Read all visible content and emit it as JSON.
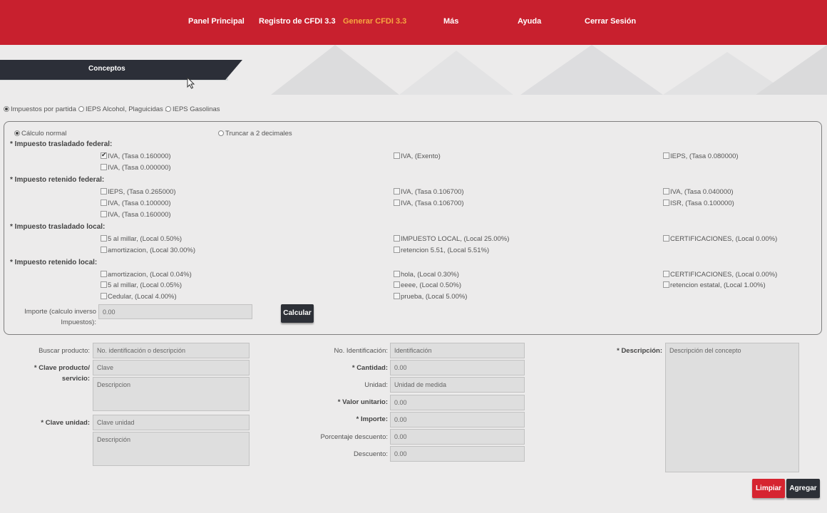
{
  "nav": {
    "items": [
      "Panel Principal",
      "Registro de CFDI 3.3",
      "Generar CFDI 3.3",
      "Más",
      "Ayuda",
      "Cerrar Sesión"
    ],
    "active_index": 2,
    "colors": {
      "bar": "#c8202e",
      "active": "#f6a640"
    }
  },
  "section": {
    "title": "Conceptos"
  },
  "tax_mode": {
    "options": [
      "Impuestos por partida",
      "IEPS Alcohol, Plaguicidas ...",
      "IEPS Gasolinas"
    ],
    "selected": 0
  },
  "calc": {
    "options": [
      "Cálculo normal",
      "Truncar a 2 decimales"
    ],
    "selected": 0
  },
  "groups": {
    "trasladado_federal": {
      "title": "* Impuesto trasladado federal:",
      "items": [
        "IVA, (Tasa 0.160000)",
        "IVA, (Exento)",
        "IEPS, (Tasa 0.080000)",
        "IVA, (Tasa 0.000000)"
      ],
      "checked": [
        true,
        false,
        false,
        false
      ]
    },
    "retenido_federal": {
      "title": "* Impuesto retenido federal:",
      "items": [
        "IEPS, (Tasa 0.265000)",
        "IVA, (Tasa 0.106700)",
        "IVA, (Tasa 0.040000)",
        "IVA, (Tasa 0.100000)",
        "IVA, (Tasa 0.106700)",
        "ISR, (Tasa 0.100000)",
        "IVA, (Tasa 0.160000)"
      ]
    },
    "trasladado_local": {
      "title": "* Impuesto trasladado local:",
      "items": [
        "5 al millar, (Local 0.50%)",
        "IMPUESTO LOCAL, (Local 25.00%)",
        "CERTIFICACIONES, (Local 0.00%)",
        "amortizacion, (Local 30.00%)",
        "retencion 5.51, (Local 5.51%)"
      ]
    },
    "retenido_local": {
      "title": "* Impuesto retenido local:",
      "items": [
        "amortizacion, (Local 0.04%)",
        "hola, (Local 0.30%)",
        "CERTIFICACIONES, (Local 0.00%)",
        "5 al millar, (Local 0.05%)",
        "eeee, (Local 0.50%)",
        "retencion estatal, (Local 1.00%)",
        "Cedular, (Local 4.00%)",
        "prueba, (Local 5.00%)"
      ]
    }
  },
  "importe_inverso": {
    "label_1": "Importe (calculo inverso",
    "label_2": "Impuestos):",
    "value": "0.00",
    "button": "Calcular"
  },
  "form": {
    "buscar": {
      "label": "Buscar producto:",
      "placeholder": "No. identificación o descripción"
    },
    "clave_prod": {
      "label_1": "* Clave producto/",
      "label_2": "servicio:",
      "placeholder": "Clave",
      "desc_placeholder": "Descripcion"
    },
    "clave_unidad": {
      "label": "* Clave unidad:",
      "placeholder": "Clave unidad",
      "desc_placeholder": "Descripción"
    },
    "no_ident": {
      "label": "No. Identificación:",
      "placeholder": "Identificación"
    },
    "cantidad": {
      "label": "* Cantidad:",
      "value": "0.00"
    },
    "unidad": {
      "label": "Unidad:",
      "placeholder": "Unidad de medida"
    },
    "valor_unitario": {
      "label": "* Valor unitario:",
      "value": "0.00"
    },
    "importe": {
      "label": "* Importe:",
      "value": "0.00"
    },
    "porcentaje_descuento": {
      "label": "Porcentaje descuento:",
      "value": "0.00"
    },
    "descuento": {
      "label": "Descuento:",
      "value": "0.00"
    },
    "descripcion": {
      "label": "* Descripción:",
      "placeholder": "Descripción del concepto"
    }
  },
  "actions": {
    "limpiar": "Limpiar",
    "agregar": "Agregar"
  }
}
